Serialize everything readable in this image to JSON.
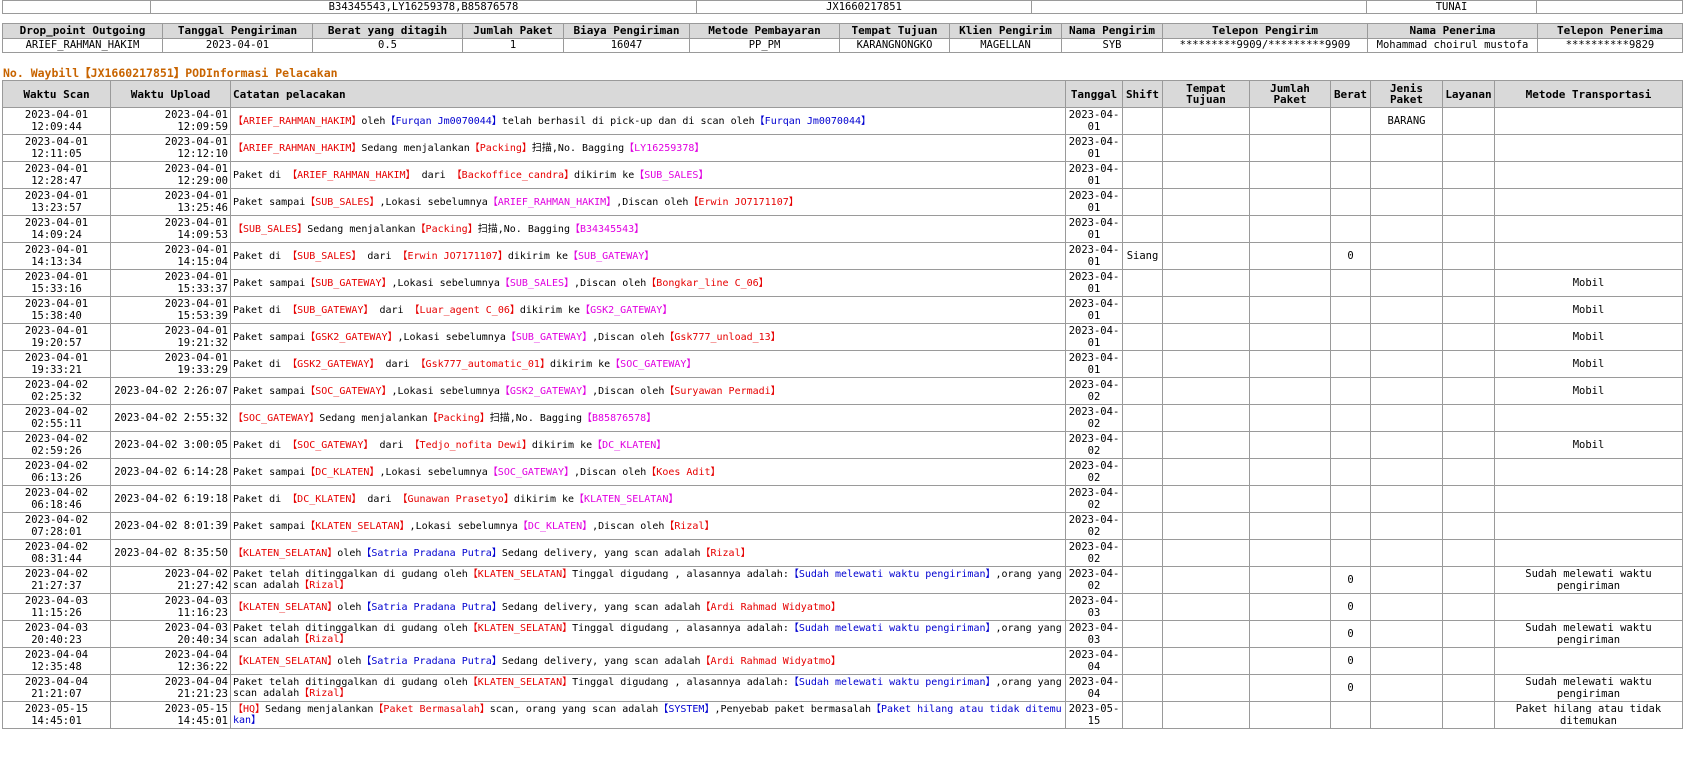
{
  "top_row": [
    "",
    "B34345543,LY16259378,B85876578",
    "JX1660217851",
    "",
    "TUNAI",
    ""
  ],
  "summary": {
    "headers": [
      "Drop_point Outgoing",
      "Tanggal Pengiriman",
      "Berat yang ditagih",
      "Jumlah Paket",
      "Biaya Pengiriman",
      "Metode Pembayaran",
      "Tempat Tujuan",
      "Klien Pengirim",
      "Nama Pengirim",
      "Telepon Pengirim",
      "Nama Penerima",
      "Telepon Penerima"
    ],
    "values": [
      "ARIEF_RAHMAN_HAKIM",
      "2023-04-01",
      "0.5",
      "1",
      "16047",
      "PP_PM",
      "KARANGNONGKO",
      "MAGELLAN",
      "SYB",
      "*********9909/*********9909",
      "Mohammad choirul mustofa",
      "**********9829"
    ]
  },
  "waybill_heading": "No. Waybill【JX1660217851】PODInformasi Pelacakan",
  "tracking": {
    "headers": [
      "Waktu Scan",
      "Waktu Upload",
      "Catatan pelacakan",
      "Tanggal",
      "Shift",
      "Tempat Tujuan",
      "Jumlah Paket",
      "Berat",
      "Jenis Paket",
      "Layanan",
      "Metode Transportasi"
    ],
    "rows": [
      {
        "scan": "2023-04-01 12:09:44",
        "upload": "2023-04-01 12:09:59",
        "note": [
          [
            "r",
            "【ARIEF_RAHMAN_HAKIM】"
          ],
          [
            "k",
            "oleh"
          ],
          [
            "b",
            "【Furqan Jm0070044】"
          ],
          [
            "k",
            "telah berhasil di pick-up dan di scan oleh"
          ],
          [
            "b",
            "【Furqan Jm0070044】"
          ]
        ],
        "date": "2023-04-01",
        "shift": "",
        "dest": "",
        "qty": "",
        "weight": "",
        "type": "BARANG",
        "service": "",
        "transport": ""
      },
      {
        "scan": "2023-04-01 12:11:05",
        "upload": "2023-04-01 12:12:10",
        "note": [
          [
            "r",
            "【ARIEF_RAHMAN_HAKIM】"
          ],
          [
            "k",
            "Sedang menjalankan"
          ],
          [
            "r",
            "【Packing】"
          ],
          [
            "k",
            "扫描,No. Bagging"
          ],
          [
            "m",
            "【LY16259378】"
          ]
        ],
        "date": "2023-04-01",
        "shift": "",
        "dest": "",
        "qty": "",
        "weight": "",
        "type": "",
        "service": "",
        "transport": ""
      },
      {
        "scan": "2023-04-01 12:28:47",
        "upload": "2023-04-01 12:29:00",
        "note": [
          [
            "k",
            "Paket di "
          ],
          [
            "r",
            "【ARIEF_RAHMAN_HAKIM】"
          ],
          [
            "k",
            " dari "
          ],
          [
            "r",
            "【Backoffice_candra】"
          ],
          [
            "k",
            "dikirim ke"
          ],
          [
            "m",
            "【SUB_SALES】"
          ]
        ],
        "date": "2023-04-01",
        "shift": "",
        "dest": "",
        "qty": "",
        "weight": "",
        "type": "",
        "service": "",
        "transport": ""
      },
      {
        "scan": "2023-04-01 13:23:57",
        "upload": "2023-04-01 13:25:46",
        "note": [
          [
            "k",
            "Paket sampai"
          ],
          [
            "r",
            "【SUB_SALES】"
          ],
          [
            "k",
            ",Lokasi sebelumnya"
          ],
          [
            "m",
            "【ARIEF_RAHMAN_HAKIM】"
          ],
          [
            "k",
            ",Discan oleh"
          ],
          [
            "r",
            "【Erwin JO7171107】"
          ]
        ],
        "date": "2023-04-01",
        "shift": "",
        "dest": "",
        "qty": "",
        "weight": "",
        "type": "",
        "service": "",
        "transport": ""
      },
      {
        "scan": "2023-04-01 14:09:24",
        "upload": "2023-04-01 14:09:53",
        "note": [
          [
            "r",
            "【SUB_SALES】"
          ],
          [
            "k",
            "Sedang menjalankan"
          ],
          [
            "r",
            "【Packing】"
          ],
          [
            "k",
            "扫描,No. Bagging"
          ],
          [
            "m",
            "【B34345543】"
          ]
        ],
        "date": "2023-04-01",
        "shift": "",
        "dest": "",
        "qty": "",
        "weight": "",
        "type": "",
        "service": "",
        "transport": ""
      },
      {
        "scan": "2023-04-01 14:13:34",
        "upload": "2023-04-01 14:15:04",
        "note": [
          [
            "k",
            "Paket di "
          ],
          [
            "r",
            "【SUB_SALES】"
          ],
          [
            "k",
            " dari "
          ],
          [
            "r",
            "【Erwin JO7171107】"
          ],
          [
            "k",
            "dikirim ke"
          ],
          [
            "m",
            "【SUB_GATEWAY】"
          ]
        ],
        "date": "2023-04-01",
        "shift": "Siang",
        "dest": "",
        "qty": "",
        "weight": "0",
        "type": "",
        "service": "",
        "transport": ""
      },
      {
        "scan": "2023-04-01 15:33:16",
        "upload": "2023-04-01 15:33:37",
        "note": [
          [
            "k",
            "Paket sampai"
          ],
          [
            "r",
            "【SUB_GATEWAY】"
          ],
          [
            "k",
            ",Lokasi sebelumnya"
          ],
          [
            "m",
            "【SUB_SALES】"
          ],
          [
            "k",
            ",Discan oleh"
          ],
          [
            "r",
            "【Bongkar_line C_06】"
          ]
        ],
        "date": "2023-04-01",
        "shift": "",
        "dest": "",
        "qty": "",
        "weight": "",
        "type": "",
        "service": "",
        "transport": "Mobil"
      },
      {
        "scan": "2023-04-01 15:38:40",
        "upload": "2023-04-01 15:53:39",
        "note": [
          [
            "k",
            "Paket di "
          ],
          [
            "r",
            "【SUB_GATEWAY】"
          ],
          [
            "k",
            " dari "
          ],
          [
            "r",
            "【Luar_agent C_06】"
          ],
          [
            "k",
            "dikirim ke"
          ],
          [
            "m",
            "【GSK2_GATEWAY】"
          ]
        ],
        "date": "2023-04-01",
        "shift": "",
        "dest": "",
        "qty": "",
        "weight": "",
        "type": "",
        "service": "",
        "transport": "Mobil"
      },
      {
        "scan": "2023-04-01 19:20:57",
        "upload": "2023-04-01 19:21:32",
        "note": [
          [
            "k",
            "Paket sampai"
          ],
          [
            "r",
            "【GSK2_GATEWAY】"
          ],
          [
            "k",
            ",Lokasi sebelumnya"
          ],
          [
            "m",
            "【SUB_GATEWAY】"
          ],
          [
            "k",
            ",Discan oleh"
          ],
          [
            "r",
            "【Gsk777_unload_13】"
          ]
        ],
        "date": "2023-04-01",
        "shift": "",
        "dest": "",
        "qty": "",
        "weight": "",
        "type": "",
        "service": "",
        "transport": "Mobil"
      },
      {
        "scan": "2023-04-01 19:33:21",
        "upload": "2023-04-01 19:33:29",
        "note": [
          [
            "k",
            "Paket di "
          ],
          [
            "r",
            "【GSK2_GATEWAY】"
          ],
          [
            "k",
            " dari "
          ],
          [
            "r",
            "【Gsk777_automatic_01】"
          ],
          [
            "k",
            "dikirim ke"
          ],
          [
            "m",
            "【SOC_GATEWAY】"
          ]
        ],
        "date": "2023-04-01",
        "shift": "",
        "dest": "",
        "qty": "",
        "weight": "",
        "type": "",
        "service": "",
        "transport": "Mobil"
      },
      {
        "scan": "2023-04-02 02:25:32",
        "upload": "2023-04-02 2:26:07",
        "note": [
          [
            "k",
            "Paket sampai"
          ],
          [
            "r",
            "【SOC_GATEWAY】"
          ],
          [
            "k",
            ",Lokasi sebelumnya"
          ],
          [
            "m",
            "【GSK2_GATEWAY】"
          ],
          [
            "k",
            ",Discan oleh"
          ],
          [
            "r",
            "【Suryawan Permadi】"
          ]
        ],
        "date": "2023-04-02",
        "shift": "",
        "dest": "",
        "qty": "",
        "weight": "",
        "type": "",
        "service": "",
        "transport": "Mobil"
      },
      {
        "scan": "2023-04-02 02:55:11",
        "upload": "2023-04-02 2:55:32",
        "note": [
          [
            "r",
            "【SOC_GATEWAY】"
          ],
          [
            "k",
            "Sedang menjalankan"
          ],
          [
            "r",
            "【Packing】"
          ],
          [
            "k",
            "扫描,No. Bagging"
          ],
          [
            "m",
            "【B85876578】"
          ]
        ],
        "date": "2023-04-02",
        "shift": "",
        "dest": "",
        "qty": "",
        "weight": "",
        "type": "",
        "service": "",
        "transport": ""
      },
      {
        "scan": "2023-04-02 02:59:26",
        "upload": "2023-04-02 3:00:05",
        "note": [
          [
            "k",
            "Paket di "
          ],
          [
            "r",
            "【SOC_GATEWAY】"
          ],
          [
            "k",
            " dari "
          ],
          [
            "r",
            "【Tedjo_nofita Dewi】"
          ],
          [
            "k",
            "dikirim ke"
          ],
          [
            "m",
            "【DC_KLATEN】"
          ]
        ],
        "date": "2023-04-02",
        "shift": "",
        "dest": "",
        "qty": "",
        "weight": "",
        "type": "",
        "service": "",
        "transport": "Mobil"
      },
      {
        "scan": "2023-04-02 06:13:26",
        "upload": "2023-04-02 6:14:28",
        "note": [
          [
            "k",
            "Paket sampai"
          ],
          [
            "r",
            "【DC_KLATEN】"
          ],
          [
            "k",
            ",Lokasi sebelumnya"
          ],
          [
            "m",
            "【SOC_GATEWAY】"
          ],
          [
            "k",
            ",Discan oleh"
          ],
          [
            "r",
            "【Koes Adit】"
          ]
        ],
        "date": "2023-04-02",
        "shift": "",
        "dest": "",
        "qty": "",
        "weight": "",
        "type": "",
        "service": "",
        "transport": ""
      },
      {
        "scan": "2023-04-02 06:18:46",
        "upload": "2023-04-02 6:19:18",
        "note": [
          [
            "k",
            "Paket di "
          ],
          [
            "r",
            "【DC_KLATEN】"
          ],
          [
            "k",
            " dari "
          ],
          [
            "r",
            "【Gunawan Prasetyo】"
          ],
          [
            "k",
            "dikirim ke"
          ],
          [
            "m",
            "【KLATEN_SELATAN】"
          ]
        ],
        "date": "2023-04-02",
        "shift": "",
        "dest": "",
        "qty": "",
        "weight": "",
        "type": "",
        "service": "",
        "transport": ""
      },
      {
        "scan": "2023-04-02 07:28:01",
        "upload": "2023-04-02 8:01:39",
        "note": [
          [
            "k",
            "Paket sampai"
          ],
          [
            "r",
            "【KLATEN_SELATAN】"
          ],
          [
            "k",
            ",Lokasi sebelumnya"
          ],
          [
            "m",
            "【DC_KLATEN】"
          ],
          [
            "k",
            ",Discan oleh"
          ],
          [
            "r",
            "【Rizal】"
          ]
        ],
        "date": "2023-04-02",
        "shift": "",
        "dest": "",
        "qty": "",
        "weight": "",
        "type": "",
        "service": "",
        "transport": ""
      },
      {
        "scan": "2023-04-02 08:31:44",
        "upload": "2023-04-02 8:35:50",
        "note": [
          [
            "r",
            "【KLATEN_SELATAN】"
          ],
          [
            "k",
            "oleh"
          ],
          [
            "b",
            "【Satria Pradana Putra】"
          ],
          [
            "k",
            "Sedang delivery, yang scan adalah"
          ],
          [
            "r",
            "【Rizal】"
          ]
        ],
        "date": "2023-04-02",
        "shift": "",
        "dest": "",
        "qty": "",
        "weight": "",
        "type": "",
        "service": "",
        "transport": ""
      },
      {
        "scan": "2023-04-02 21:27:37",
        "upload": "2023-04-02 21:27:42",
        "note": [
          [
            "k",
            "Paket telah ditinggalkan di gudang oleh"
          ],
          [
            "r",
            "【KLATEN_SELATAN】"
          ],
          [
            "k",
            "Tinggal digudang , alasannya adalah:"
          ],
          [
            "b",
            "【Sudah melewati waktu pengiriman】"
          ],
          [
            "k",
            ",orang yang scan adalah"
          ],
          [
            "r",
            "【Rizal】"
          ]
        ],
        "date": "2023-04-02",
        "shift": "",
        "dest": "",
        "qty": "",
        "weight": "0",
        "type": "",
        "service": "",
        "transport": "Sudah melewati waktu pengiriman"
      },
      {
        "scan": "2023-04-03 11:15:26",
        "upload": "2023-04-03 11:16:23",
        "note": [
          [
            "r",
            "【KLATEN_SELATAN】"
          ],
          [
            "k",
            "oleh"
          ],
          [
            "b",
            "【Satria Pradana Putra】"
          ],
          [
            "k",
            "Sedang delivery, yang scan adalah"
          ],
          [
            "r",
            "【Ardi Rahmad Widyatmo】"
          ]
        ],
        "date": "2023-04-03",
        "shift": "",
        "dest": "",
        "qty": "",
        "weight": "0",
        "type": "",
        "service": "",
        "transport": ""
      },
      {
        "scan": "2023-04-03 20:40:23",
        "upload": "2023-04-03 20:40:34",
        "note": [
          [
            "k",
            "Paket telah ditinggalkan di gudang oleh"
          ],
          [
            "r",
            "【KLATEN_SELATAN】"
          ],
          [
            "k",
            "Tinggal digudang , alasannya adalah:"
          ],
          [
            "b",
            "【Sudah melewati waktu pengiriman】"
          ],
          [
            "k",
            ",orang yang scan adalah"
          ],
          [
            "r",
            "【Rizal】"
          ]
        ],
        "date": "2023-04-03",
        "shift": "",
        "dest": "",
        "qty": "",
        "weight": "0",
        "type": "",
        "service": "",
        "transport": "Sudah melewati waktu pengiriman"
      },
      {
        "scan": "2023-04-04 12:35:48",
        "upload": "2023-04-04 12:36:22",
        "note": [
          [
            "r",
            "【KLATEN_SELATAN】"
          ],
          [
            "k",
            "oleh"
          ],
          [
            "b",
            "【Satria Pradana Putra】"
          ],
          [
            "k",
            "Sedang delivery, yang scan adalah"
          ],
          [
            "r",
            "【Ardi Rahmad Widyatmo】"
          ]
        ],
        "date": "2023-04-04",
        "shift": "",
        "dest": "",
        "qty": "",
        "weight": "0",
        "type": "",
        "service": "",
        "transport": ""
      },
      {
        "scan": "2023-04-04 21:21:07",
        "upload": "2023-04-04 21:21:23",
        "note": [
          [
            "k",
            "Paket telah ditinggalkan di gudang oleh"
          ],
          [
            "r",
            "【KLATEN_SELATAN】"
          ],
          [
            "k",
            "Tinggal digudang , alasannya adalah:"
          ],
          [
            "b",
            "【Sudah melewati waktu pengiriman】"
          ],
          [
            "k",
            ",orang yang scan adalah"
          ],
          [
            "r",
            "【Rizal】"
          ]
        ],
        "date": "2023-04-04",
        "shift": "",
        "dest": "",
        "qty": "",
        "weight": "0",
        "type": "",
        "service": "",
        "transport": "Sudah melewati waktu pengiriman"
      },
      {
        "scan": "2023-05-15 14:45:01",
        "upload": "2023-05-15 14:45:01",
        "note": [
          [
            "r",
            "【HQ】"
          ],
          [
            "k",
            "Sedang menjalankan"
          ],
          [
            "r",
            "【Paket Bermasalah】"
          ],
          [
            "k",
            "scan, orang yang scan adalah"
          ],
          [
            "b",
            "【SYSTEM】"
          ],
          [
            "k",
            ",Penyebab paket bermasalah"
          ],
          [
            "b",
            "【Paket hilang atau tidak ditemukan】"
          ]
        ],
        "date": "2023-05-15",
        "shift": "",
        "dest": "",
        "qty": "",
        "weight": "",
        "type": "",
        "service": "",
        "transport": "Paket hilang atau tidak ditemukan"
      }
    ]
  },
  "colors": {
    "header_bg": "#d9d9d9",
    "heading": "#c86400",
    "red": "#e60000",
    "blue": "#0000d0",
    "magenta": "#e000e0"
  }
}
